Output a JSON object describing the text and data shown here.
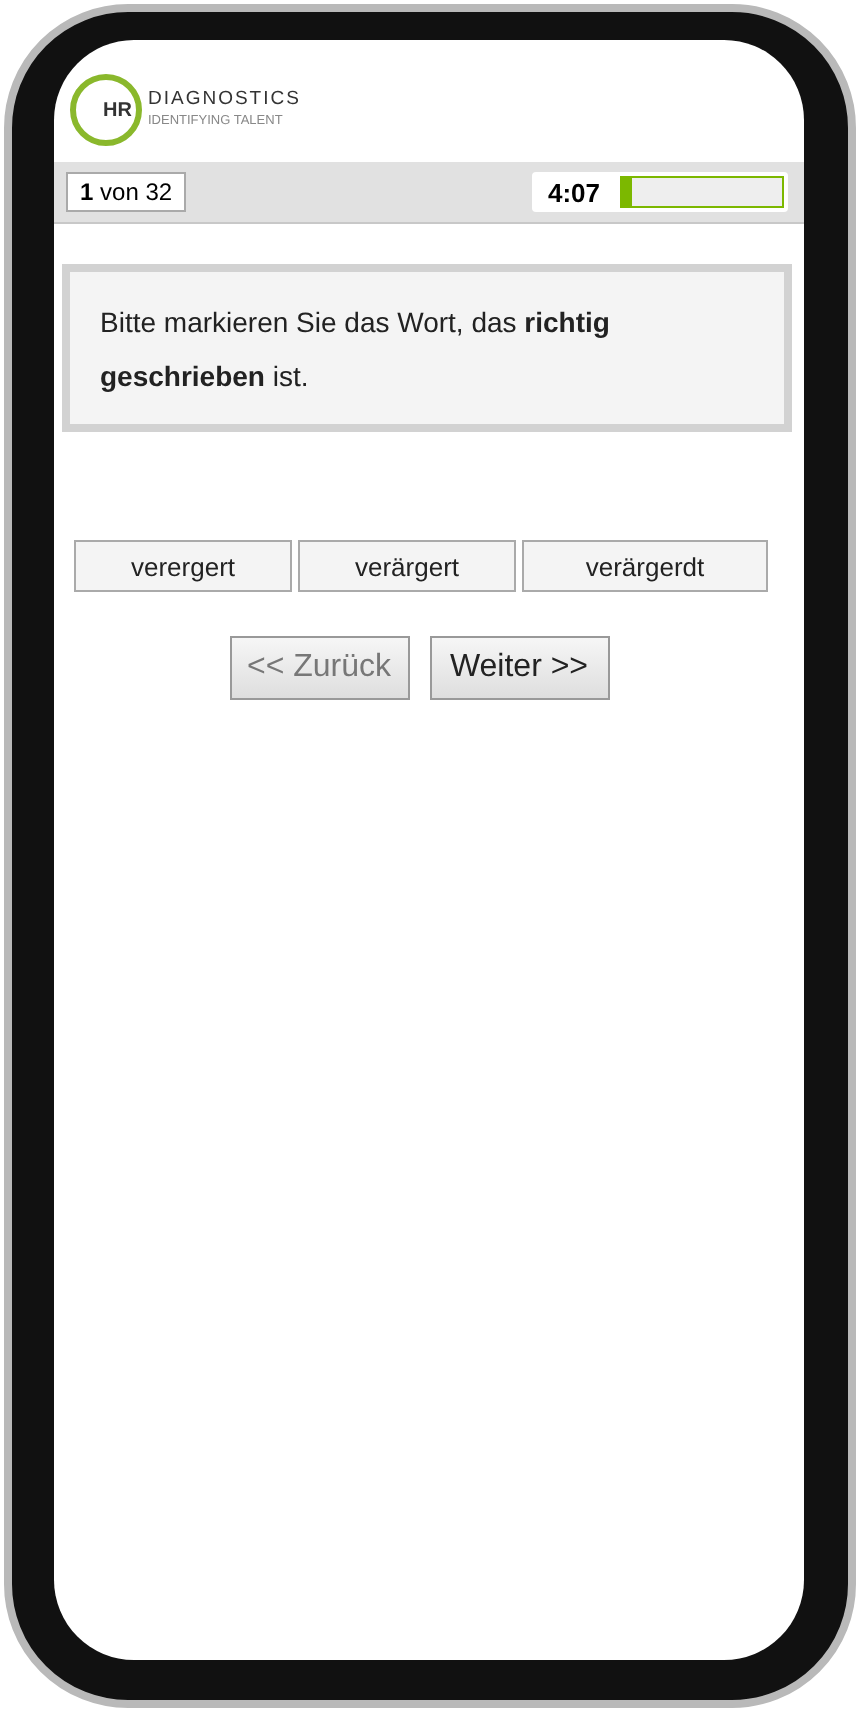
{
  "logo": {
    "mark": "HR",
    "name": "DIAGNOSTICS",
    "tagline": "IDENTIFYING TALENT"
  },
  "progress": {
    "counter": "**1** von 32",
    "timer": "4:07",
    "level": 0.06
  },
  "question": "Bitte markieren Sie das Wort, das **richtig geschrieben** ist.",
  "options": [
    {
      "label": "verergert",
      "selected": false
    },
    {
      "label": "verärgert",
      "selected": false
    },
    {
      "label": "verärgerdt",
      "selected": false
    }
  ],
  "nav": [
    {
      "label": "<< Zurück",
      "disabled": true
    },
    {
      "label": "Weiter >>",
      "disabled": false
    }
  ]
}
